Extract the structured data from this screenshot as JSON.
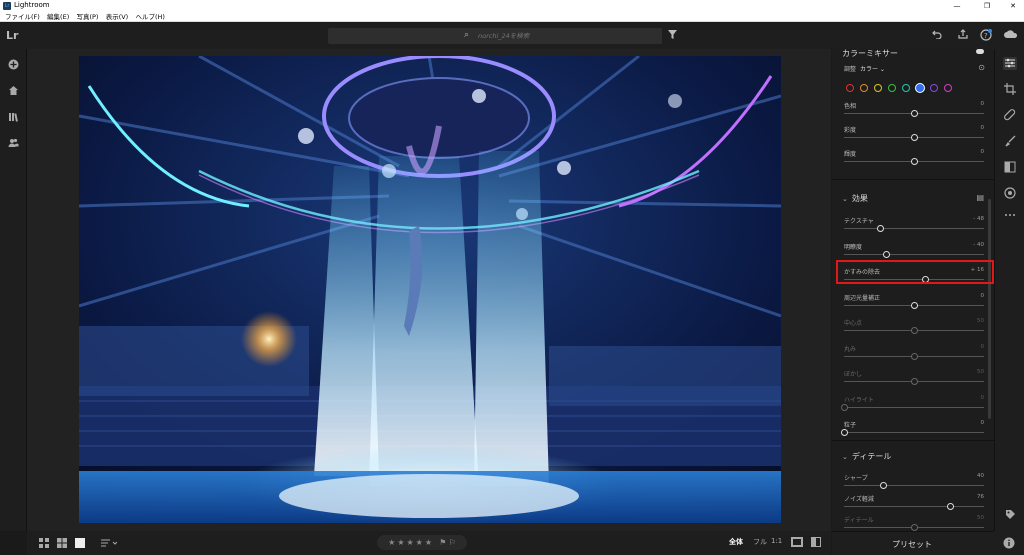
{
  "titlebar": {
    "title": "Lightroom",
    "icon": "Lr",
    "minimize": "—",
    "maximize": "❐",
    "close": "✕"
  },
  "menu": [
    "ファイル(F)",
    "編集(E)",
    "写真(P)",
    "表示(V)",
    "ヘルプ(H)"
  ],
  "toolbar": {
    "logo": "Lr",
    "search_placeholder": "norchi_24を検索",
    "icons": [
      "filter-icon",
      "undo-icon",
      "share-icon",
      "help-icon",
      "cloud-icon"
    ]
  },
  "left_icons": [
    "add-icon",
    "home-icon",
    "library-icon",
    "people-icon"
  ],
  "right_icons": [
    "edit-sliders-icon",
    "crop-icon",
    "healing-icon",
    "brush-icon",
    "linear-gradient-icon",
    "radial-gradient-icon",
    "more-icon",
    "tag-icon",
    "info-icon"
  ],
  "panel": {
    "color_mixer": {
      "title": "カラーミキサー",
      "adjust_label": "調整",
      "adjust_value": "カラー",
      "swatches": [
        "#e03030",
        "#e08a28",
        "#d8c820",
        "#3cbf3c",
        "#1fc7b7",
        "#3070f0",
        "#8b48e0",
        "#d040c0"
      ],
      "selected_swatch": 5,
      "sliders": [
        {
          "label": "色相",
          "value": "0",
          "pos": 0.5
        },
        {
          "label": "彩度",
          "value": "0",
          "pos": 0.5
        },
        {
          "label": "輝度",
          "value": "0",
          "pos": 0.5
        }
      ]
    },
    "effects": {
      "title": "効果",
      "sliders": [
        {
          "label": "テクスチャ",
          "value": "- 48",
          "pos": 0.26,
          "dim": false
        },
        {
          "label": "明瞭度",
          "value": "- 40",
          "pos": 0.3,
          "dim": false
        },
        {
          "label": "かすみの除去",
          "value": "+ 16",
          "pos": 0.58,
          "dim": false
        },
        {
          "label": "周辺光量補正",
          "value": "0",
          "pos": 0.5,
          "dim": false
        },
        {
          "label": "中心点",
          "value": "50",
          "pos": 0.5,
          "dim": true
        },
        {
          "label": "丸み",
          "value": "0",
          "pos": 0.5,
          "dim": true
        },
        {
          "label": "ぼかし",
          "value": "50",
          "pos": 0.5,
          "dim": true
        },
        {
          "label": "ハイライト",
          "value": "0",
          "pos": 0.0,
          "dim": true
        },
        {
          "label": "粒子",
          "value": "0",
          "pos": 0.0,
          "dim": false
        }
      ]
    },
    "detail": {
      "title": "ディテール",
      "sliders": [
        {
          "label": "シャープ",
          "value": "40",
          "pos": 0.28,
          "dim": false
        },
        {
          "label": "ノイズ軽減",
          "value": "76",
          "pos": 0.76,
          "dim": false
        },
        {
          "label": "ディテール",
          "value": "50",
          "pos": 0.5,
          "dim": true
        }
      ]
    }
  },
  "bottom": {
    "stars": "★★★★★",
    "zoom_options": [
      "全体",
      "フル",
      "1:1"
    ],
    "presets_label": "プリセット"
  }
}
